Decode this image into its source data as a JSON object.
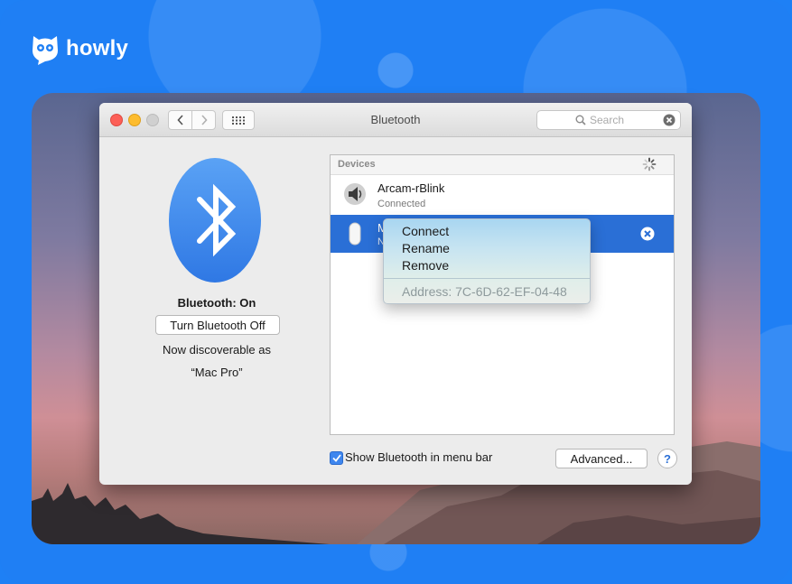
{
  "brand": {
    "name": "howly"
  },
  "window": {
    "title": "Bluetooth"
  },
  "toolbar": {
    "back_icon": "chevron-left-icon",
    "forward_icon": "chevron-right-icon",
    "grid_icon": "grid-icon"
  },
  "search": {
    "placeholder": "Search",
    "value": ""
  },
  "bluetooth": {
    "status": "Bluetooth: On",
    "toggle_label": "Turn Bluetooth Off",
    "discoverable_line1": "Now discoverable as",
    "discoverable_line2": "“Mac Pro”"
  },
  "devices": {
    "header": "Devices",
    "items": [
      {
        "name": "Arcam-rBlink",
        "status": "Connected",
        "icon": "speaker-icon",
        "selected": false
      },
      {
        "name_fragment": "M",
        "status_fragment": "N",
        "icon": "mouse-icon",
        "selected": true
      }
    ]
  },
  "context_menu": {
    "items": [
      "Connect",
      "Rename",
      "Remove"
    ],
    "address": "Address: 7C-6D-62-EF-04-48"
  },
  "footer": {
    "show_in_menubar_label": "Show Bluetooth in menu bar",
    "show_in_menubar_checked": true,
    "advanced_label": "Advanced...",
    "help_label": "?"
  },
  "colors": {
    "background": "#1f7ff4",
    "selection": "#2a6fd6",
    "bluetooth_badge": "#3f8ef0"
  }
}
